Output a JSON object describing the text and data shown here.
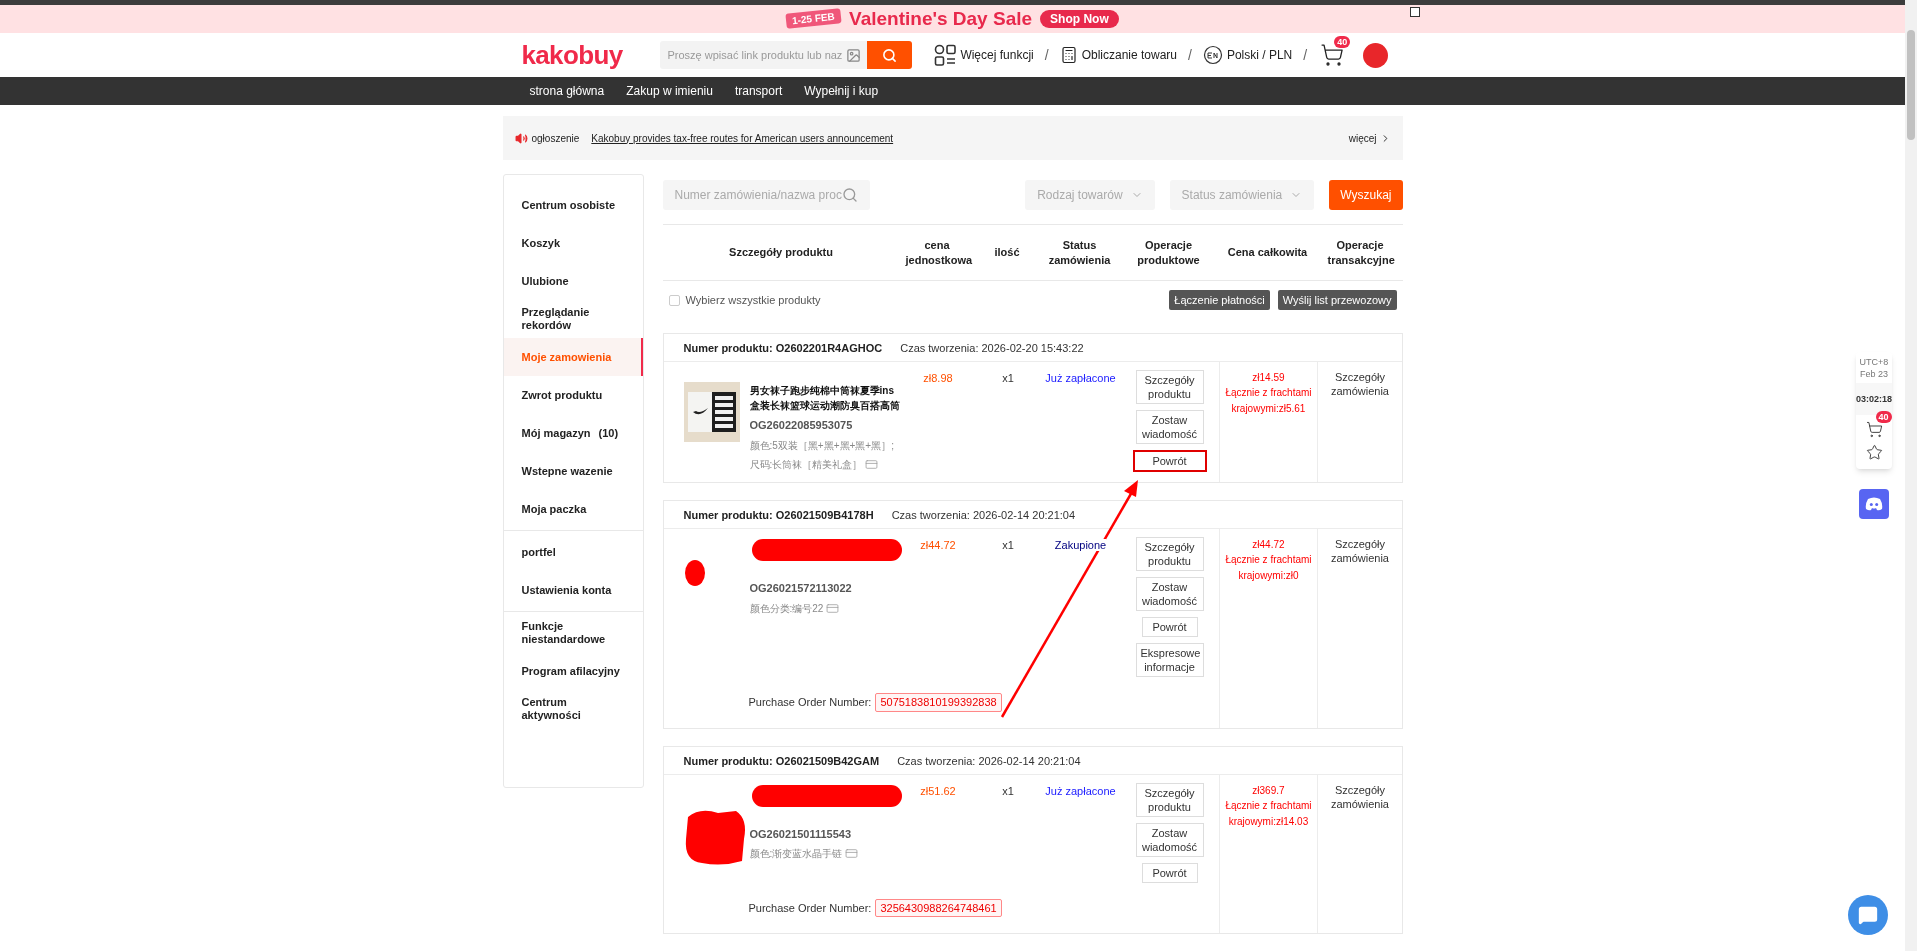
{
  "banner": {
    "date_badge": "1-25 FEB",
    "title": "Valentine's Day Sale",
    "button": "Shop Now"
  },
  "header": {
    "logo": "kakobuy",
    "search_placeholder": "Proszę wpisać link produktu lub naz",
    "links": [
      {
        "kind": "grid",
        "label": "Więcej funkcji"
      },
      {
        "kind": "calculator",
        "label": "Obliczanie towaru"
      },
      {
        "kind": "language",
        "label": "Polski / PLN"
      }
    ],
    "separator": "/",
    "cart_badge": "40"
  },
  "nav": [
    "strona główna",
    "Zakup w imieniu",
    "transport",
    "Wypełnij i kup"
  ],
  "announcement": {
    "label": "ogłoszenie",
    "text": "Kakobuy provides tax-free routes for American users announcement",
    "more": "więcej"
  },
  "sidebar": {
    "groups": [
      [
        {
          "label": "Centrum osobiste",
          "selected": false
        },
        {
          "label": "Koszyk",
          "selected": false
        },
        {
          "label": "Ulubione",
          "selected": false
        },
        {
          "label": "Przeglądanie rekordów",
          "selected": false
        },
        {
          "label": "Moje zamowienia",
          "selected": true
        },
        {
          "label": "Zwrot produktu",
          "selected": false
        },
        {
          "label": "Mój magazyn",
          "count": "(10)",
          "selected": false
        },
        {
          "label": "Wstepne wazenie",
          "selected": false
        },
        {
          "label": "Moja paczka",
          "selected": false
        }
      ],
      [
        {
          "label": "portfel",
          "selected": false
        },
        {
          "label": "Ustawienia konta",
          "selected": false
        }
      ],
      [
        {
          "label": "Funkcje niestandardowe",
          "selected": false
        },
        {
          "label": "Program afilacyjny",
          "selected": false
        },
        {
          "label": "Centrum aktywności",
          "selected": false
        }
      ]
    ]
  },
  "filters": {
    "search_placeholder": "Numer zamówienia/nazwa proc",
    "selects": [
      "Rodzaj towarów",
      "Status zamówienia"
    ],
    "button": "Wyszukaj"
  },
  "table": {
    "columns": [
      "Szczegóły produktu",
      "cena jednostkowa",
      "ilość",
      "Status zamówienia",
      "Operacje produktowe",
      "Cena całkowita",
      "Operacje transakcyjne"
    ]
  },
  "select_all": {
    "label": "Wybierz wszystkie produkty",
    "checked": false
  },
  "bulk_actions": [
    "Łączenie płatności",
    "Wyślij list przewozowy"
  ],
  "orders": [
    {
      "number_label": "Numer produktu:",
      "number": "O2602201R4AGHOC",
      "created": "Czas tworzenia: 2026-02-20 15:43:22",
      "redacted": false,
      "name": "男女袜子跑步纯棉中筒袜夏季ins盒装长袜篮球运动潮防臭百搭高筒",
      "code": "OG26022085953075",
      "attributes": [
        "颜色:5双装［黑+黑+黑+黑+黑］;",
        "尺码:长筒袜［精美礼盒］"
      ],
      "price": "zł8.98",
      "qty": "x1",
      "status": "Już zapłacone",
      "color": "#1a1aff",
      "ops": [
        {
          "label": "Szczegóły produktu",
          "highlighted": false
        },
        {
          "label": "Zostaw wiadomość",
          "highlighted": false
        },
        {
          "label": "Powrót",
          "highlighted": true
        }
      ],
      "total": "zł14.59",
      "total_note": "Łącznie z frachtami krajowymi:zł5.61",
      "transaction_op": "Szczegóły zamówienia"
    },
    {
      "number_label": "Numer produktu:",
      "number": "O26021509B4178H",
      "created": "Czas tworzenia: 2026-02-14 20:21:04",
      "redacted": true,
      "code": "OG26021572113022",
      "attributes": [
        "颜色分类:编号22"
      ],
      "price": "zł44.72",
      "qty": "x1",
      "status": "Zakupione",
      "color": "#000080",
      "ops": [
        {
          "label": "Szczegóły produktu",
          "highlighted": false
        },
        {
          "label": "Zostaw wiadomość",
          "highlighted": false
        },
        {
          "label": "Powrót",
          "highlighted": false
        },
        {
          "label": "Ekspresowe informacje",
          "highlighted": false
        }
      ],
      "total": "zł44.72",
      "total_note": "Łącznie z frachtami krajowymi:zł0",
      "transaction_op": "Szczegóły zamówienia",
      "purchase_order": {
        "label": "Purchase Order Number:",
        "number": "5075183810199392838"
      }
    },
    {
      "number_label": "Numer produktu:",
      "number": "O26021509B42GAM",
      "created": "Czas tworzenia: 2026-02-14 20:21:04",
      "redacted": true,
      "code": "OG26021501115543",
      "attributes": [
        "颜色:渐变蓝水晶手链"
      ],
      "price": "zł51.62",
      "qty": "x1",
      "status": "Już zapłacone",
      "color": "#1a1aff",
      "ops": [
        {
          "label": "Szczegóły produktu",
          "highlighted": false
        },
        {
          "label": "Zostaw wiadomość",
          "highlighted": false
        },
        {
          "label": "Powrót",
          "highlighted": false
        }
      ],
      "total": "zł369.7",
      "total_note": "Łącznie z frachtami krajowymi:zł14.03",
      "transaction_op": "Szczegóły zamówienia",
      "purchase_order": {
        "label": "Purchase Order Number:",
        "number": "3256430988264748461"
      }
    }
  ],
  "annotations": [
    {
      "kind": "arrow"
    }
  ],
  "side_widget": {
    "timezone": "UTC+8",
    "date": "Feb 23",
    "time": "03:02:18",
    "cart_badge": "40"
  }
}
